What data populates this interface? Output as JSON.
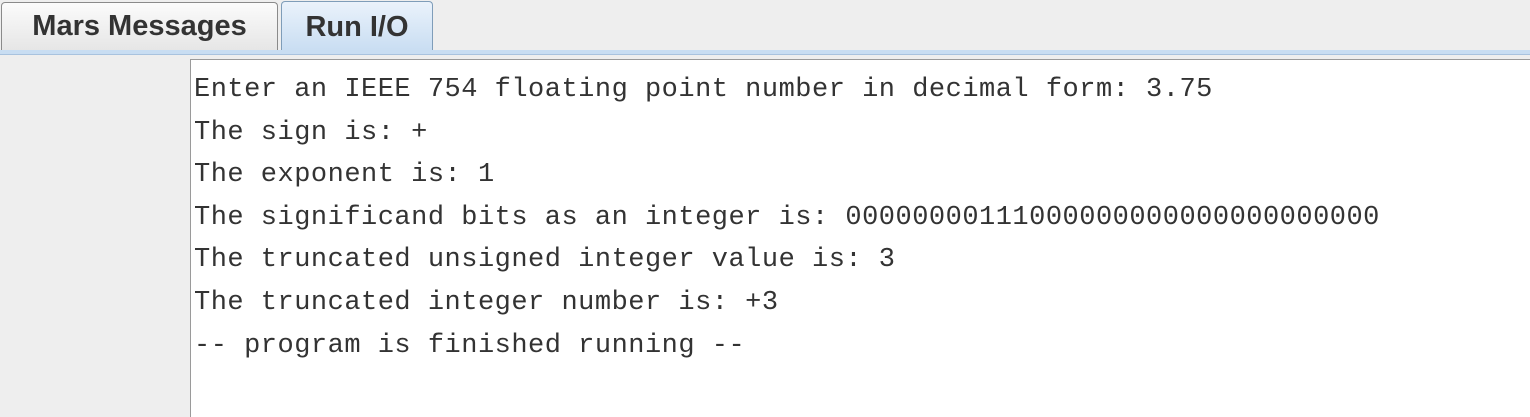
{
  "tabs": [
    {
      "label": "Mars Messages",
      "selected": false
    },
    {
      "label": "Run I/O",
      "selected": true
    }
  ],
  "console": {
    "lines": [
      "Enter an IEEE 754 floating point number in decimal form: 3.75",
      "The sign is: +",
      "The exponent is: 1",
      "The significand bits as an integer is: 00000000111000000000000000000000",
      "The truncated unsigned integer value is: 3",
      "The truncated integer number is: +3",
      "-- program is finished running --"
    ]
  },
  "colors": {
    "selected_tab": "#c8ddf2",
    "background": "#eeeeee",
    "console_background": "#ffffff"
  }
}
